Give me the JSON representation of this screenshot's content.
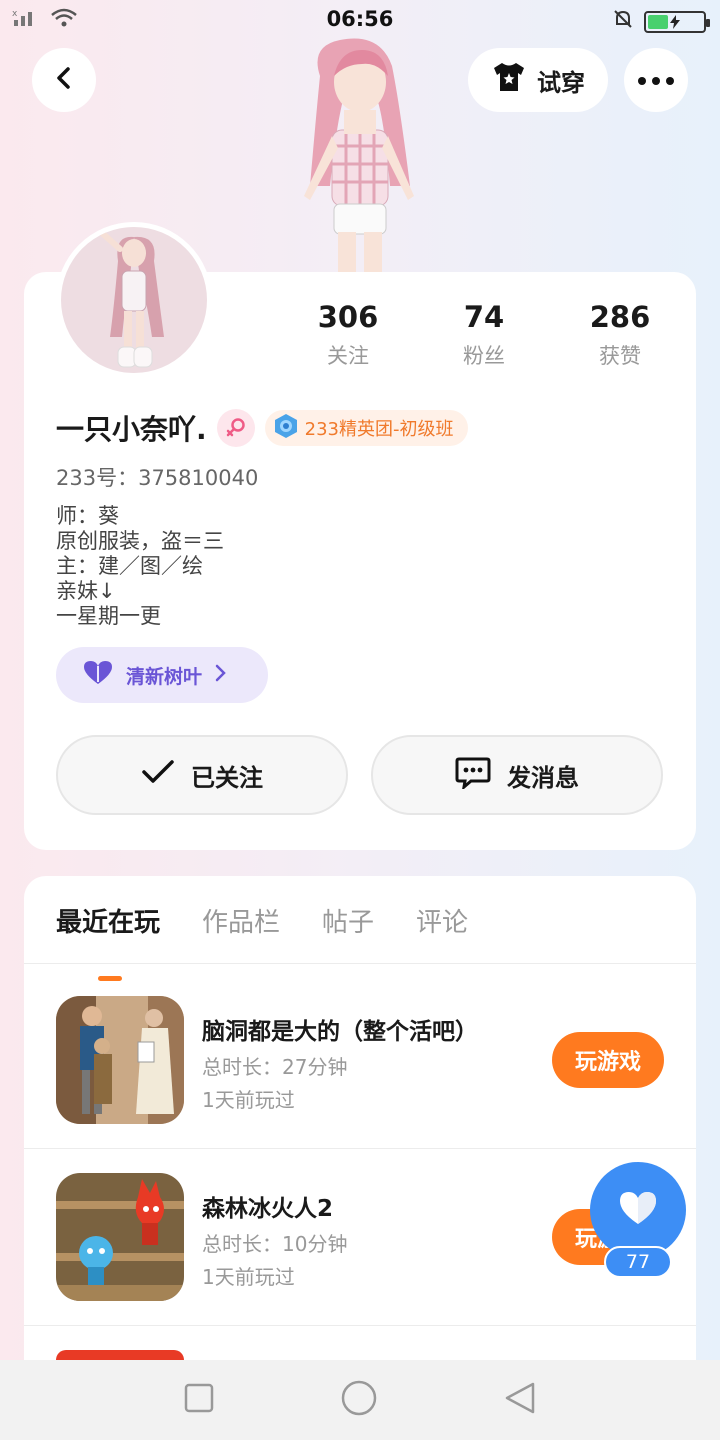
{
  "status_bar": {
    "time": "06:56"
  },
  "header": {
    "try_on_label": "试穿"
  },
  "stats": [
    {
      "num": "306",
      "label": "关注"
    },
    {
      "num": "74",
      "label": "粉丝"
    },
    {
      "num": "286",
      "label": "获赞"
    }
  ],
  "profile": {
    "name": "一只小奈吖.",
    "badge": "233精英团-初级班",
    "uid": "233号：375810040",
    "bio": [
      "师：葵",
      "原创服装，盗＝三",
      "主：建／图／绘",
      "亲妹↓",
      "一星期一更"
    ],
    "leaf_label": "清新树叶"
  },
  "actions": {
    "follow_label": "已关注",
    "message_label": "发消息"
  },
  "tabs": [
    "最近在玩",
    "作品栏",
    "帖子",
    "评论"
  ],
  "games": [
    {
      "title": "脑洞都是大的（整个活吧）",
      "duration": "总时长：27分钟",
      "last_played": "1天前玩过",
      "button": "玩游戏"
    },
    {
      "title": "森林冰火人2",
      "duration": "总时长：10分钟",
      "last_played": "1天前玩过",
      "button": "玩游戏"
    }
  ],
  "like": {
    "count": "77"
  },
  "colors": {
    "accent": "#ff7a1f",
    "like_blue": "#3d8ef5",
    "leaf_purple": "#6a55d6"
  }
}
